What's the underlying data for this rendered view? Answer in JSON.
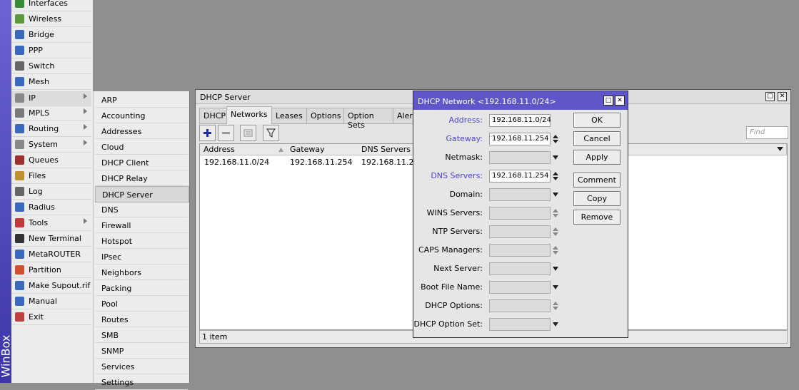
{
  "brand": "WinBox",
  "main_menu": [
    {
      "label": "Interfaces",
      "icon": "interfaces-icon",
      "arrow": false
    },
    {
      "label": "Wireless",
      "icon": "wireless-icon",
      "arrow": false
    },
    {
      "label": "Bridge",
      "icon": "bridge-icon",
      "arrow": false
    },
    {
      "label": "PPP",
      "icon": "ppp-icon",
      "arrow": false
    },
    {
      "label": "Switch",
      "icon": "switch-icon",
      "arrow": false
    },
    {
      "label": "Mesh",
      "icon": "mesh-icon",
      "arrow": false
    },
    {
      "label": "IP",
      "icon": "ip-icon",
      "arrow": true
    },
    {
      "label": "MPLS",
      "icon": "mpls-icon",
      "arrow": true
    },
    {
      "label": "Routing",
      "icon": "routing-icon",
      "arrow": true
    },
    {
      "label": "System",
      "icon": "system-icon",
      "arrow": true
    },
    {
      "label": "Queues",
      "icon": "queues-icon",
      "arrow": false
    },
    {
      "label": "Files",
      "icon": "files-icon",
      "arrow": false
    },
    {
      "label": "Log",
      "icon": "log-icon",
      "arrow": false
    },
    {
      "label": "Radius",
      "icon": "radius-icon",
      "arrow": false
    },
    {
      "label": "Tools",
      "icon": "tools-icon",
      "arrow": true
    },
    {
      "label": "New Terminal",
      "icon": "terminal-icon",
      "arrow": false
    },
    {
      "label": "MetaROUTER",
      "icon": "metarouter-icon",
      "arrow": false
    },
    {
      "label": "Partition",
      "icon": "partition-icon",
      "arrow": false
    },
    {
      "label": "Make Supout.rif",
      "icon": "supout-icon",
      "arrow": false
    },
    {
      "label": "Manual",
      "icon": "manual-icon",
      "arrow": false
    },
    {
      "label": "Exit",
      "icon": "exit-icon",
      "arrow": false
    }
  ],
  "ip_submenu": [
    "ARP",
    "Accounting",
    "Addresses",
    "Cloud",
    "DHCP Client",
    "DHCP Relay",
    "DHCP Server",
    "DNS",
    "Firewall",
    "Hotspot",
    "IPsec",
    "Neighbors",
    "Packing",
    "Pool",
    "Routes",
    "SMB",
    "SNMP",
    "Services",
    "Settings"
  ],
  "dhcp_server": {
    "title": "DHCP Server",
    "tabs": [
      "DHCP",
      "Networks",
      "Leases",
      "Options",
      "Option Sets",
      "Alerts"
    ],
    "active_tab": "Networks",
    "find_placeholder": "Find",
    "columns": [
      "Address",
      "Gateway",
      "DNS Servers"
    ],
    "rows": [
      [
        "192.168.11.0/24",
        "192.168.11.254",
        "192.168.11.254"
      ]
    ],
    "status": "1 item"
  },
  "dialog": {
    "title": "DHCP Network <192.168.11.0/24>",
    "fields": [
      {
        "label": "Address:",
        "value": "192.168.11.0/24",
        "blue": true,
        "control": "none"
      },
      {
        "label": "Gateway:",
        "value": "192.168.11.254",
        "blue": true,
        "control": "spin"
      },
      {
        "label": "Netmask:",
        "value": "",
        "blue": false,
        "control": "dropdown"
      },
      {
        "label": "DNS Servers:",
        "value": "192.168.11.254",
        "blue": true,
        "control": "spin"
      },
      {
        "label": "Domain:",
        "value": "",
        "blue": false,
        "control": "dropdown"
      },
      {
        "label": "WINS Servers:",
        "value": "",
        "blue": false,
        "control": "spin-disabled"
      },
      {
        "label": "NTP Servers:",
        "value": "",
        "blue": false,
        "control": "spin-disabled"
      },
      {
        "label": "CAPS Managers:",
        "value": "",
        "blue": false,
        "control": "spin-disabled"
      },
      {
        "label": "Next Server:",
        "value": "",
        "blue": false,
        "control": "dropdown"
      },
      {
        "label": "Boot File Name:",
        "value": "",
        "blue": false,
        "control": "dropdown"
      },
      {
        "label": "DHCP Options:",
        "value": "",
        "blue": false,
        "control": "spin-disabled"
      },
      {
        "label": "DHCP Option Set:",
        "value": "",
        "blue": false,
        "control": "dropdown"
      }
    ],
    "buttons": [
      "OK",
      "Cancel",
      "Apply",
      "Comment",
      "Copy",
      "Remove"
    ]
  },
  "colors": {
    "title_bar": "#5f57c9",
    "label_blue": "#4a43d0",
    "brand": "#4b44b8"
  }
}
